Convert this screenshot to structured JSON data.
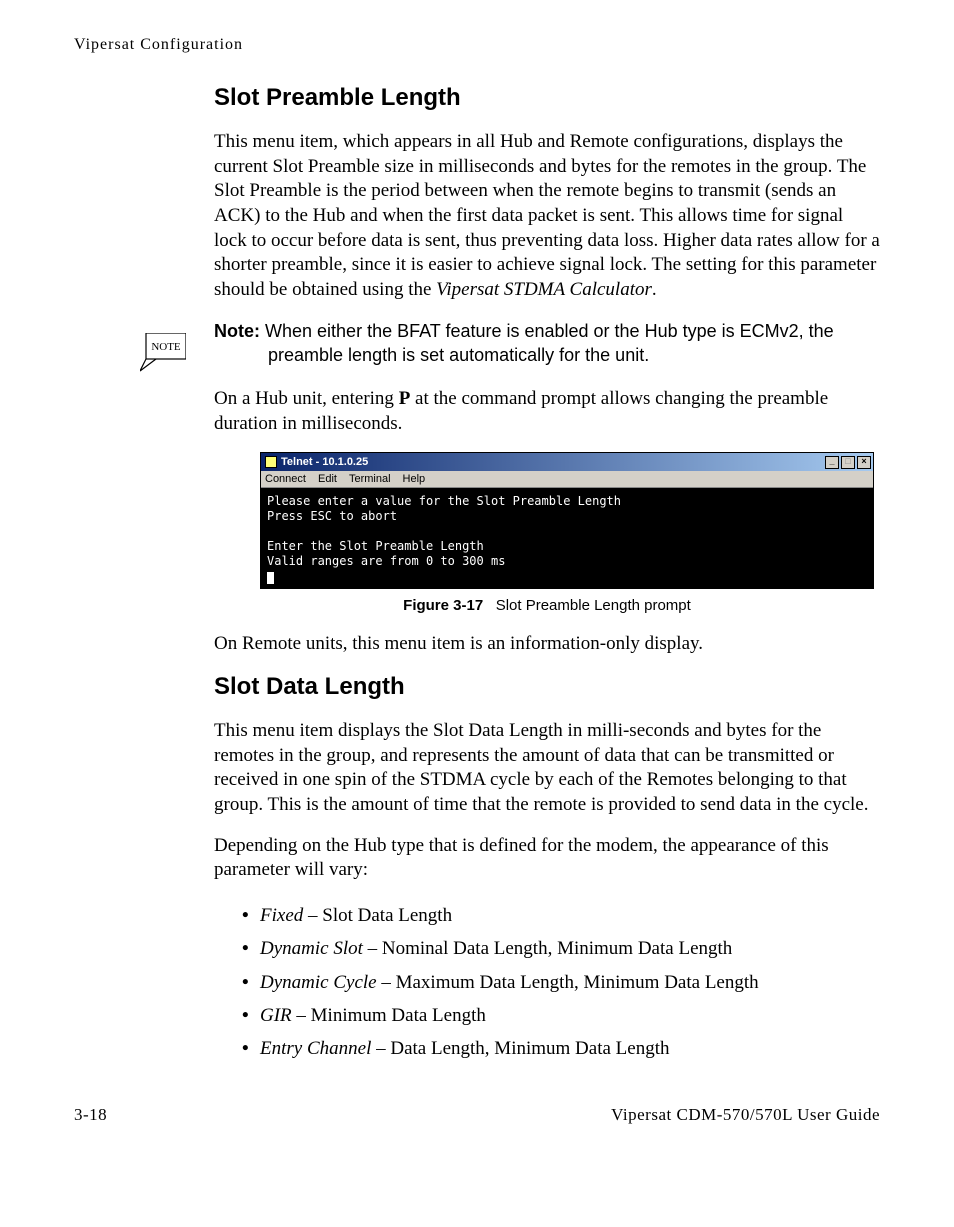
{
  "running_head": "Vipersat Configuration",
  "section1": {
    "heading": "Slot Preamble Length",
    "para1_pre": "This menu item, which appears in all Hub and Remote configurations, displays the current Slot Preamble size in milliseconds and bytes for the remotes in the group. The Slot Preamble is the period between when the remote begins to transmit (sends an ACK) to the Hub and when the first data packet is sent. This allows time for signal lock to occur before data is sent, thus preventing data loss. Higher data rates allow for a shorter preamble, since it is easier to achieve signal lock. The setting for this parameter should be obtained using the ",
    "para1_em": "Vipersat STDMA Calculator",
    "para1_post": "."
  },
  "note": {
    "icon_label": "NOTE",
    "label": "Note:",
    "body_line1": "When either the BFAT feature is enabled or the Hub type is ECMv2, the",
    "body_line2": "preamble length is set automatically for the unit."
  },
  "section1b": {
    "para2_pre": "On a Hub unit, entering ",
    "para2_bold": "P",
    "para2_post": " at the command prompt allows changing the preamble duration in milliseconds."
  },
  "telnet": {
    "title": "Telnet - 10.1.0.25",
    "menu": [
      "Connect",
      "Edit",
      "Terminal",
      "Help"
    ],
    "line1": "Please enter a value for the Slot Preamble Length",
    "line2": "Press ESC to abort",
    "line3": "Enter the Slot Preamble Length",
    "line4": "Valid ranges are from 0 to 300 ms",
    "btn_min": "_",
    "btn_max": "□",
    "btn_close": "×"
  },
  "figure": {
    "num": "Figure 3-17",
    "caption": "Slot Preamble Length prompt"
  },
  "section1c": {
    "para3": "On Remote units, this menu item is an information-only display."
  },
  "section2": {
    "heading": "Slot Data Length",
    "para1": "This menu item displays the Slot Data Length in milli-seconds and bytes for the remotes in the group, and represents the amount of data that can be transmitted or received in one spin of the STDMA cycle by each of the Remotes belonging to that group. This is the amount of time that the remote is provided to send data in the cycle.",
    "para2": "Depending on the Hub type that is defined for the modem, the appearance of this parameter will vary:",
    "bullets": [
      {
        "em": "Fixed",
        "rest": " – Slot Data Length"
      },
      {
        "em": "Dynamic Slot",
        "rest": " – Nominal Data Length, Minimum Data Length"
      },
      {
        "em": "Dynamic Cycle",
        "rest": " – Maximum Data Length, Minimum Data Length"
      },
      {
        "em": "GIR",
        "rest": " – Minimum Data Length"
      },
      {
        "em": "Entry Channel",
        "rest": " – Data Length, Minimum Data Length"
      }
    ]
  },
  "footer": {
    "left": "3-18",
    "right": "Vipersat CDM-570/570L User Guide"
  }
}
